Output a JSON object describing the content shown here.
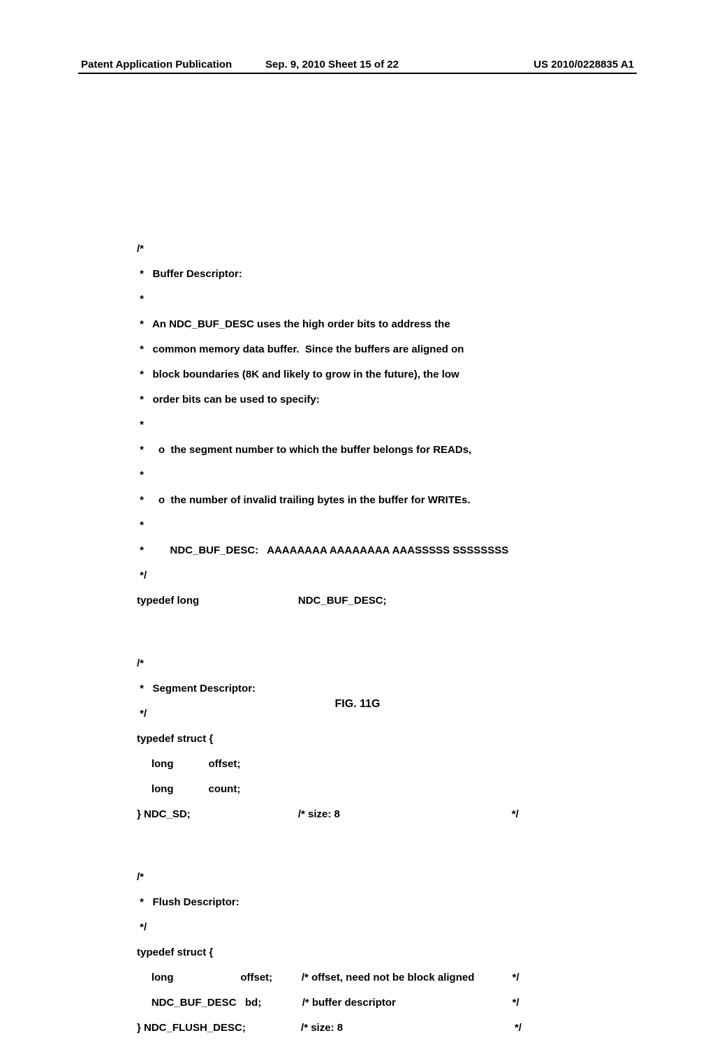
{
  "header": {
    "left": "Patent Application Publication",
    "center": "Sep. 9, 2010  Sheet 15 of 22",
    "right": "US 2010/0228835 A1"
  },
  "code": {
    "block1_line1": "/*",
    "block1_line2": " *   Buffer Descriptor:",
    "block1_line3": " *",
    "block1_line4": " *   An NDC_BUF_DESC uses the high order bits to address the",
    "block1_line5": " *   common memory data buffer.  Since the buffers are aligned on",
    "block1_line6": " *   block boundaries (8K and likely to grow in the future), the low",
    "block1_line7": " *   order bits can be used to specify:",
    "block1_line8": " *",
    "block1_line9": " *     o  the segment number to which the buffer belongs for READs,",
    "block1_line10": " *",
    "block1_line11": " *     o  the number of invalid trailing bytes in the buffer for WRITEs.",
    "block1_line12": " *",
    "block1_line13": " *         NDC_BUF_DESC:   AAAAAAAA AAAAAAAA AAASSSSS SSSSSSSS",
    "block1_line14": " */",
    "block1_line15": "typedef long                                  NDC_BUF_DESC;",
    "block2_line1": "/*",
    "block2_line2": " *   Segment Descriptor:",
    "block2_line3": " */",
    "block2_line4": "typedef struct {",
    "block2_line5": "     long            offset;",
    "block2_line6": "     long            count;",
    "block2_line7": "} NDC_SD;                                     /* size: 8                                                           */",
    "block3_line1": "/*",
    "block3_line2": " *   Flush Descriptor:",
    "block3_line3": " */",
    "block3_line4": "typedef struct {",
    "block3_line5": "     long                       offset;          /* offset, need not be block aligned             */",
    "block3_line6": "     NDC_BUF_DESC   bd;              /* buffer descriptor                                        */",
    "block3_line7": "} NDC_FLUSH_DESC;                   /* size: 8                                                           */"
  },
  "figure": {
    "label": "FIG. 11G"
  }
}
